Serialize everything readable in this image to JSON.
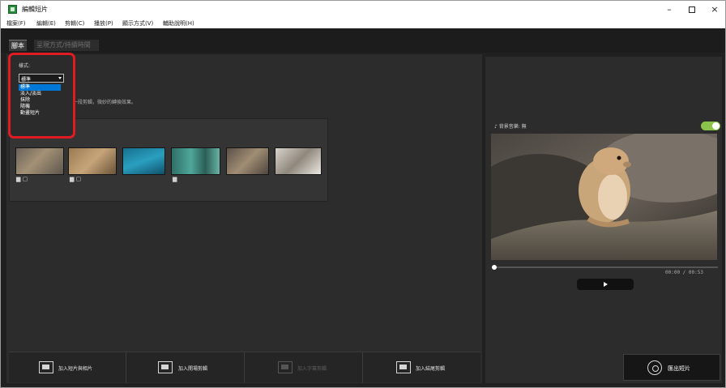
{
  "window": {
    "title": "編輯短片",
    "controls": {
      "minimize": "–",
      "close": "×"
    }
  },
  "menu": [
    "檔案(F)",
    "編輯(E)",
    "剪輯(C)",
    "播放(P)",
    "顯示方式(V)",
    "輔助說明(H)"
  ],
  "tabs": [
    {
      "label": "腳本",
      "active": true
    },
    {
      "label": "呈現方式/持續時間",
      "active": false
    }
  ],
  "style_dropdown": {
    "label": "樣式:",
    "selected": "標準",
    "options": [
      "標準",
      "淡入/淡出",
      "抹除",
      "隨機",
      "動畫短片"
    ]
  },
  "hint_text": "一段剪輯，微妙的轉換效果。",
  "thumbnails": [
    {
      "icons": "▆ ▢"
    },
    {
      "icons": "▆ ▢"
    },
    {
      "icons": ""
    },
    {
      "icons": "▆"
    },
    {
      "icons": ""
    },
    {
      "icons": ""
    }
  ],
  "toolbar": {
    "add_clips": "加入短片與相片",
    "add_opening": "加入開場剪輯",
    "add_caption": "加入字幕剪輯",
    "add_ending": "加入結尾剪輯"
  },
  "preview": {
    "music_label": "♪ 背景音樂: 無",
    "time": "00:00 / 00:53",
    "export_label": "匯出短片"
  },
  "colors": {
    "accent_blue": "#0078d7",
    "toggle_green": "#8bc34a",
    "callout_red": "#e11b22"
  }
}
